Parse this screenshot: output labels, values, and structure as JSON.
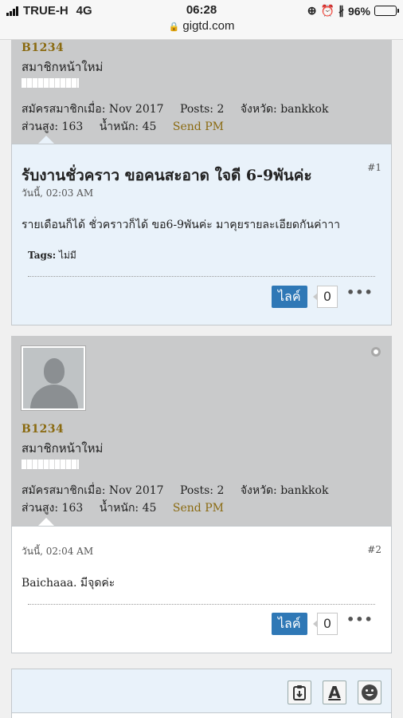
{
  "status_bar": {
    "carrier": "TRUE-H",
    "network": "4G",
    "time": "06:28",
    "url": "gigtd.com",
    "battery": "96%",
    "battery_level": 0.96
  },
  "posts": [
    {
      "user": {
        "name": "B1234",
        "title": "สมาชิกหน้าใหม่",
        "joined_label": "สมัครสมาชิกเมื่อ:",
        "joined": "Nov 2017",
        "posts_label": "Posts:",
        "posts": "2",
        "province_label": "จังหวัด:",
        "province": "bankkok",
        "height_label": "ส่วนสูง:",
        "height": "163",
        "weight_label": "น้ำหนัก:",
        "weight": "45",
        "send_pm": "Send PM"
      },
      "title": "รับงานชั่วคราว ขอคนสะอาด ใจดี 6-9พันค่ะ",
      "date": "วันนี้, 02:03 AM",
      "number": "#1",
      "body": "รายเดือนก็ได้ ชั่วคราวก็ได้ ขอ6-9พันค่ะ มาคุยรายละเอียดกันค่าาา",
      "tags_label": "Tags:",
      "tags": "ไม่มี",
      "like_label": "ไลค์",
      "like_count": "0",
      "more": "•••"
    },
    {
      "user": {
        "name": "B1234",
        "title": "สมาชิกหน้าใหม่",
        "joined_label": "สมัครสมาชิกเมื่อ:",
        "joined": "Nov 2017",
        "posts_label": "Posts:",
        "posts": "2",
        "province_label": "จังหวัด:",
        "province": "bankkok",
        "height_label": "ส่วนสูง:",
        "height": "163",
        "weight_label": "น้ำหนัก:",
        "weight": "45",
        "send_pm": "Send PM"
      },
      "date": "วันนี้, 02:04 AM",
      "number": "#2",
      "body": "Baichaaa. มีจุดค่ะ",
      "like_label": "ไลค์",
      "like_count": "0",
      "more": "•••"
    }
  ],
  "editor": {
    "tool_icons": [
      "clipboard-icon",
      "text-format-icon",
      "smiley-icon"
    ],
    "format_letter": "A"
  }
}
